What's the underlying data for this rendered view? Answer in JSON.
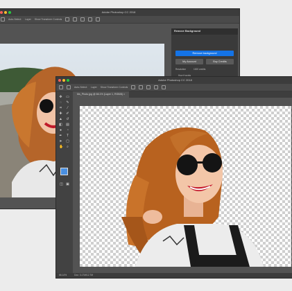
{
  "back_window": {
    "title": "Adobe Photoshop CC 2018",
    "options": [
      "Auto-Select:",
      "Layer",
      "Show Transform Controls"
    ],
    "panel": {
      "title": "Remove Background",
      "remove_button": "Remove background",
      "account_button": "My Account",
      "credits_button": "Buy Credits",
      "size_label": "Resolution",
      "size_value": "1000 credits",
      "link": "How it works"
    }
  },
  "front_window": {
    "title": "Adobe Photoshop CC 2018",
    "options": [
      "Auto-Select:",
      "Layer",
      "Show Transform Controls"
    ],
    "tab_label": "Ms_Photo.jpg @ 66.1% (Layer 1, RGB/8) ×",
    "zoom": "66.14%",
    "doc_info": "Doc: 3.17M/12.7M"
  },
  "colors": {
    "accent": "#1473e6",
    "fg_swatch": "#4a90e2",
    "bg_swatch": "#5aa0ff"
  },
  "icons": [
    "move-icon",
    "marquee-icon",
    "lasso-icon",
    "quick-select-icon",
    "crop-icon",
    "eyedropper-icon",
    "healing-icon",
    "brush-icon",
    "stamp-icon",
    "history-brush-icon",
    "eraser-icon",
    "gradient-icon",
    "blur-icon",
    "dodge-icon",
    "pen-icon",
    "type-icon",
    "path-select-icon",
    "shape-icon",
    "hand-icon",
    "zoom-icon"
  ]
}
